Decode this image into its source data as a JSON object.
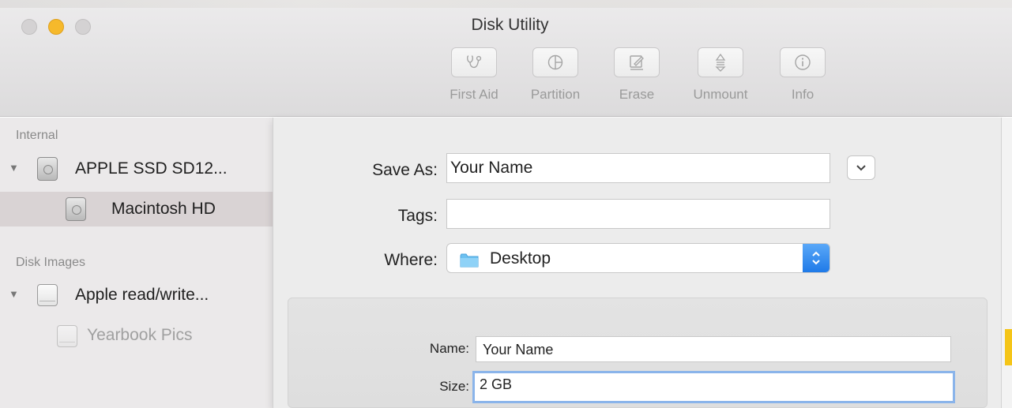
{
  "window": {
    "title": "Disk Utility"
  },
  "toolbar": {
    "first_aid": "First Aid",
    "partition": "Partition",
    "erase": "Erase",
    "unmount": "Unmount",
    "info": "Info"
  },
  "sidebar": {
    "internal_header": "Internal",
    "internal_disk": "APPLE SSD SD12...",
    "internal_volume": "Macintosh HD",
    "images_header": "Disk Images",
    "image_disk": "Apple read/write...",
    "image_volume": "Yearbook Pics"
  },
  "save_sheet": {
    "save_as_label": "Save As:",
    "save_as_value": "Your Name",
    "tags_label": "Tags:",
    "tags_value": "",
    "where_label": "Where:",
    "where_value": "Desktop",
    "name_label": "Name:",
    "name_value": "Your Name",
    "size_label": "Size:",
    "size_value": "2 GB"
  },
  "colors": {
    "accent": "#1f7ae8",
    "minimize": "#f6b92b",
    "focus_ring": "#8ab4ea",
    "selection": "#d9d3d4"
  }
}
